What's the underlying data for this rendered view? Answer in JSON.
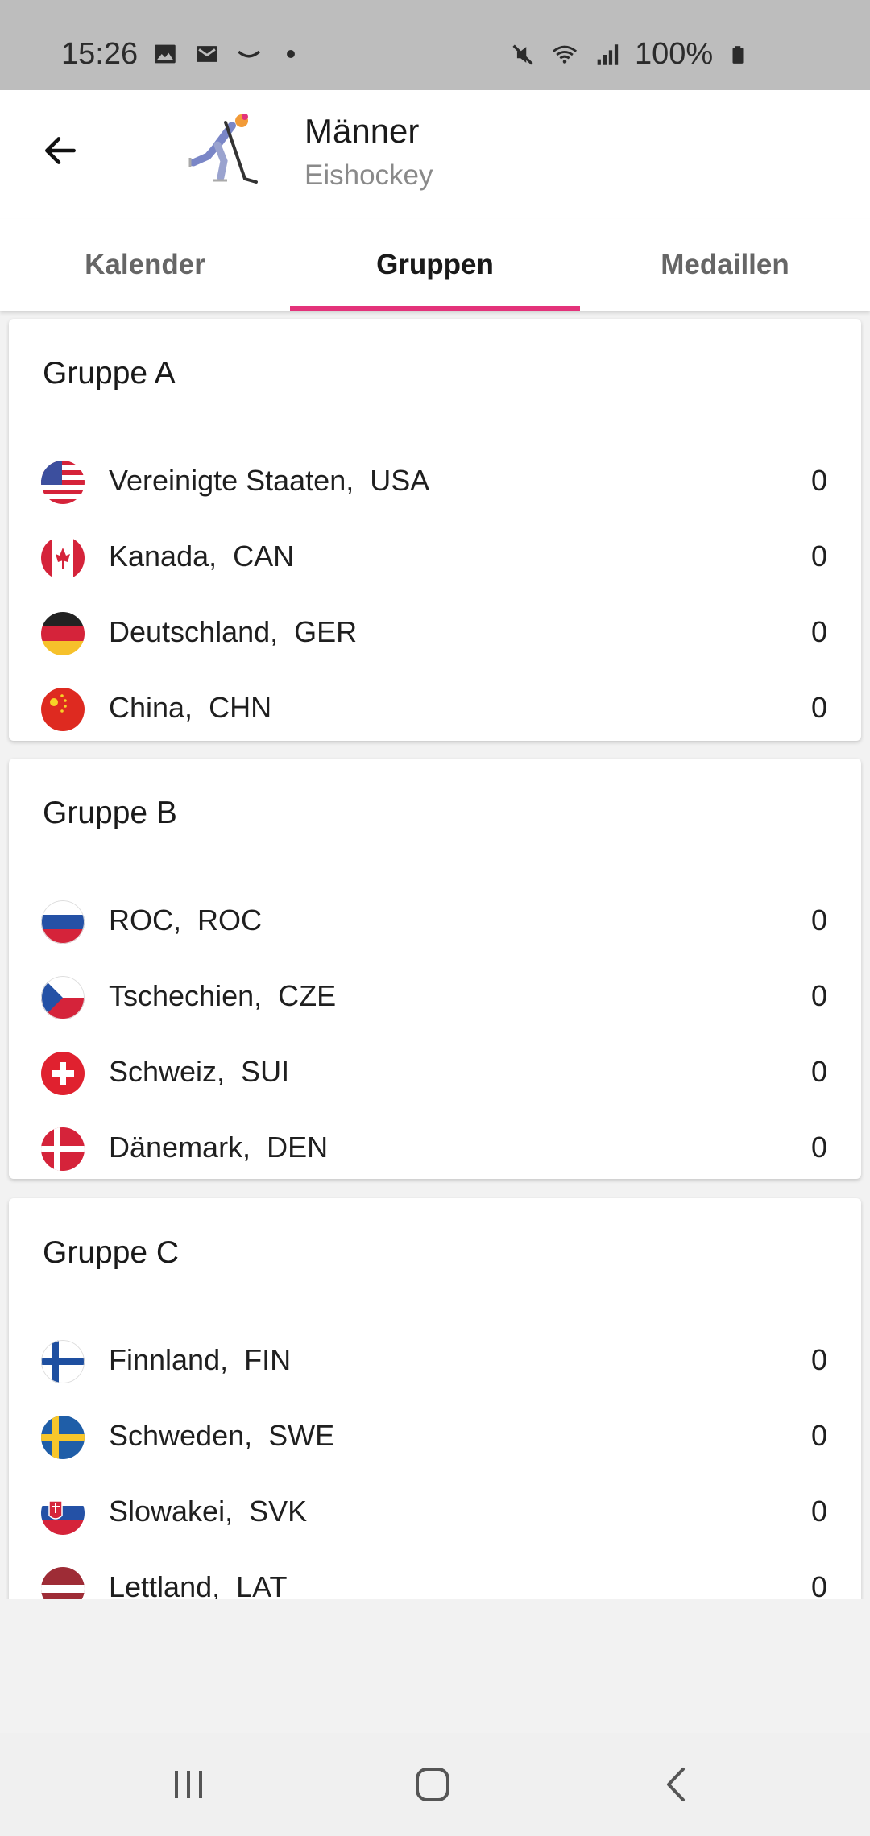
{
  "status_bar": {
    "time": "15:26",
    "battery": "100%",
    "left_icons": [
      "image-icon",
      "mail-icon",
      "smile-icon",
      "dot-icon"
    ],
    "right_icons": [
      "mute-icon",
      "wifi-icon",
      "signal-icon",
      "battery-icon"
    ]
  },
  "app_bar": {
    "title": "Männer",
    "subtitle": "Eishockey",
    "back_icon": "arrow-left-icon",
    "sport_icon": "ice-hockey-icon"
  },
  "tabs": [
    {
      "label": "Kalender",
      "active": false
    },
    {
      "label": "Gruppen",
      "active": true
    },
    {
      "label": "Medaillen",
      "active": false
    }
  ],
  "accent_color": "#e3327a",
  "groups": [
    {
      "title": "Gruppe A",
      "teams": [
        {
          "name": "Vereinigte Staaten,  USA",
          "points": "0",
          "flag": "usa-flag-icon"
        },
        {
          "name": "Kanada,  CAN",
          "points": "0",
          "flag": "canada-flag-icon"
        },
        {
          "name": "Deutschland,  GER",
          "points": "0",
          "flag": "germany-flag-icon"
        },
        {
          "name": "China,  CHN",
          "points": "0",
          "flag": "china-flag-icon"
        }
      ]
    },
    {
      "title": "Gruppe B",
      "teams": [
        {
          "name": "ROC,  ROC",
          "points": "0",
          "flag": "roc-flag-icon"
        },
        {
          "name": "Tschechien,  CZE",
          "points": "0",
          "flag": "czech-flag-icon"
        },
        {
          "name": "Schweiz,  SUI",
          "points": "0",
          "flag": "switzerland-flag-icon"
        },
        {
          "name": "Dänemark,  DEN",
          "points": "0",
          "flag": "denmark-flag-icon"
        }
      ]
    },
    {
      "title": "Gruppe C",
      "teams": [
        {
          "name": "Finnland,  FIN",
          "points": "0",
          "flag": "finland-flag-icon"
        },
        {
          "name": "Schweden,  SWE",
          "points": "0",
          "flag": "sweden-flag-icon"
        },
        {
          "name": "Slowakei,  SVK",
          "points": "0",
          "flag": "slovakia-flag-icon"
        },
        {
          "name": "Lettland,  LAT",
          "points": "0",
          "flag": "latvia-flag-icon"
        }
      ]
    }
  ],
  "nav_bar": {
    "icons": [
      "recent-apps-icon",
      "home-icon",
      "back-icon"
    ]
  }
}
